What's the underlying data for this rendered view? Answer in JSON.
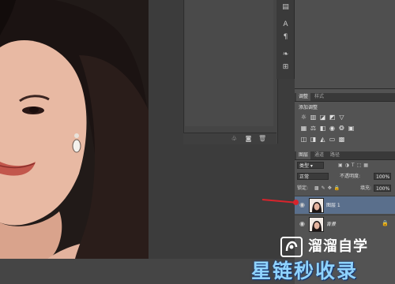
{
  "adjustments": {
    "tabs": [
      "调整",
      "样式"
    ],
    "title": "添加调整"
  },
  "layers_panel": {
    "tabs": [
      "图层",
      "通道",
      "路径"
    ],
    "kind_label": "类型",
    "blend_mode": "正常",
    "opacity_label": "不透明度:",
    "opacity_value": "100%",
    "lock_label": "锁定:",
    "fill_label": "填充:",
    "fill_value": "100%",
    "layers": [
      {
        "name": "图层 1",
        "selected": true
      },
      {
        "name": "背景",
        "selected": false
      }
    ]
  },
  "watermark": {
    "line1": "溜溜自学",
    "line2": "星链秒收录"
  },
  "colors": {
    "selection": "#5a6f8c",
    "arrow": "#d8242c",
    "watermark_text": "#8fd3ff"
  },
  "icons": [
    "add-style-icon",
    "mask-icon",
    "delete-icon",
    "eye-icon",
    "lock-icon",
    "brightness-icon",
    "levels-icon",
    "curves-icon",
    "exposure-icon"
  ]
}
